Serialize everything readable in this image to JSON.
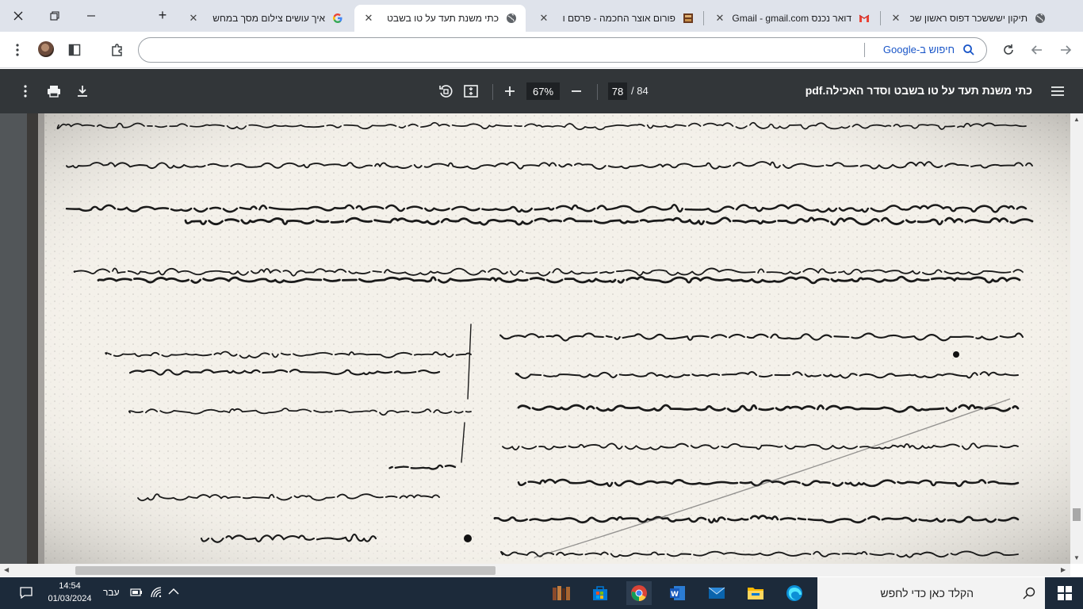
{
  "browser": {
    "tabs": [
      {
        "title": "תיקון ישששכר דפוס ראשון שכ",
        "icon": "globe-icon",
        "active": false
      },
      {
        "title": "דואר נכנס Gmail - gmail.com",
        "icon": "gmail-icon",
        "active": false
      },
      {
        "title": "פורום אוצר החכמה - פרסם ו",
        "icon": "forum-icon",
        "active": false
      },
      {
        "title": "כתי משנת תעד על טו בשבט",
        "icon": "globe-icon",
        "active": true
      },
      {
        "title": "איך עושים צילום מסך במחש",
        "icon": "google-icon",
        "active": false
      }
    ],
    "omnibox_placeholder": "חיפוש ב-Google"
  },
  "pdf": {
    "filename": "כתי משנת תעד על טו בשבט וסדר האכילה.pdf",
    "current_page": "78",
    "total_pages": "/  84",
    "zoom": "67%"
  },
  "taskbar": {
    "search_placeholder": "הקלד כאן כדי לחפש",
    "time": "14:54",
    "date": "01/03/2024",
    "language": "עבר"
  },
  "colors": {
    "tabbar_bg": "#dfe3eb",
    "pdf_toolbar_bg": "#323639",
    "viewer_bg": "#525659",
    "taskbar_bg": "#1c2a3a"
  }
}
